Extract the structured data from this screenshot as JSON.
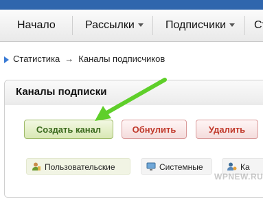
{
  "nav": {
    "items": [
      {
        "label": "Начало"
      },
      {
        "label": "Рассылки"
      },
      {
        "label": "Подписчики"
      },
      {
        "label": "Ст"
      }
    ]
  },
  "breadcrumb": {
    "first": "Статистика",
    "arrow": "→",
    "current": "Каналы подписчиков"
  },
  "panel": {
    "title": "Каналы подписки",
    "buttons": {
      "create": "Создать канал",
      "reset": "Обнулить",
      "delete": "Удалить"
    },
    "tabs": {
      "user": "Пользовательские",
      "system": "Системные",
      "other": "Ка"
    }
  },
  "watermark": "WPNEW.RU",
  "colors": {
    "topbar": "#2f66ad",
    "arrow": "#5fcf2a",
    "create_button_text": "#3b6a1e",
    "red_button_text": "#c0392b"
  }
}
